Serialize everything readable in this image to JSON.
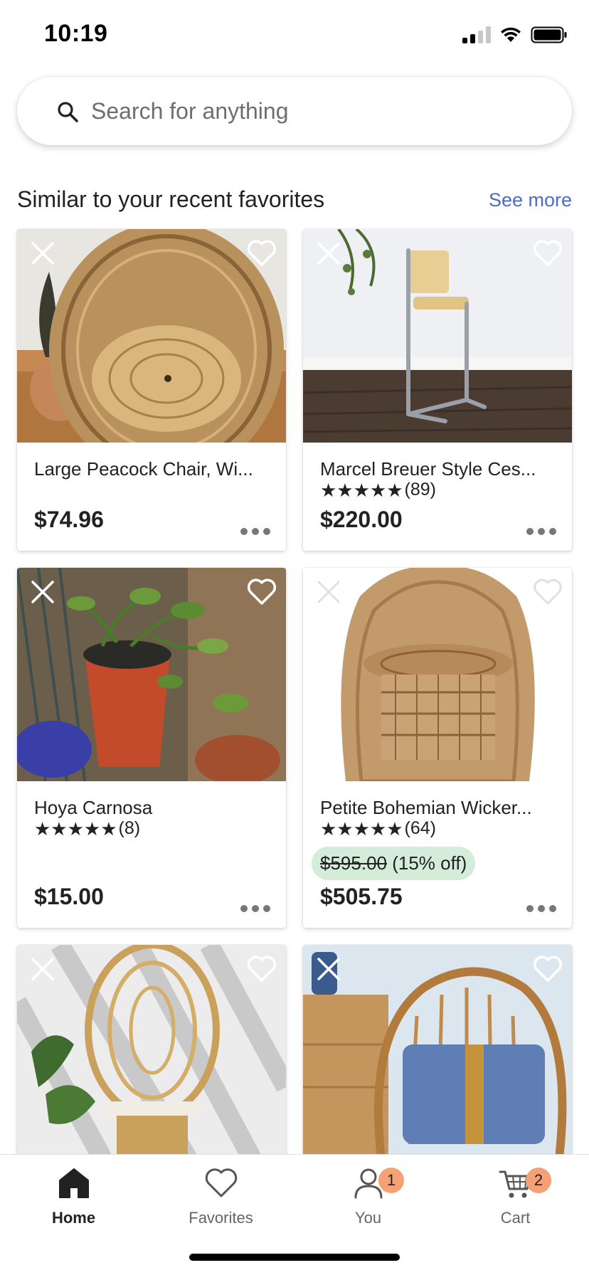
{
  "status_bar": {
    "time": "10:19"
  },
  "search": {
    "placeholder": "Search for anything",
    "value": ""
  },
  "section": {
    "title": "Similar to your recent favorites",
    "see_more": "See more"
  },
  "listings": [
    {
      "title": "Large Peacock Chair, Wi...",
      "rating": "",
      "reviews": "",
      "price": "$74.96",
      "original_price": "",
      "discount": ""
    },
    {
      "title": "Marcel Breuer Style Ces...",
      "rating": "★★★★★",
      "reviews": "(89)",
      "price": "$220.00",
      "original_price": "",
      "discount": ""
    },
    {
      "title": "Hoya Carnosa",
      "rating": "★★★★★",
      "reviews": "(8)",
      "price": "$15.00",
      "original_price": "",
      "discount": ""
    },
    {
      "title": "Petite Bohemian Wicker...",
      "rating": "★★★★★",
      "reviews": "(64)",
      "price": "$505.75",
      "original_price": "$595.00",
      "discount": "(15% off)"
    },
    {
      "title": "",
      "rating": "",
      "reviews": "",
      "price": "",
      "original_price": "",
      "discount": ""
    },
    {
      "title": "",
      "rating": "",
      "reviews": "",
      "price": "",
      "original_price": "",
      "discount": ""
    }
  ],
  "tabs": [
    {
      "label": "Home",
      "icon": "home-icon",
      "active": true,
      "badge": ""
    },
    {
      "label": "Favorites",
      "icon": "heart-icon",
      "active": false,
      "badge": ""
    },
    {
      "label": "You",
      "icon": "person-icon",
      "active": false,
      "badge": "1"
    },
    {
      "label": "Cart",
      "icon": "cart-icon",
      "active": false,
      "badge": "2"
    }
  ],
  "colors": {
    "accent": "#4d6bc6",
    "badge": "#f5a075",
    "discount_bg": "#d4ecd9"
  }
}
